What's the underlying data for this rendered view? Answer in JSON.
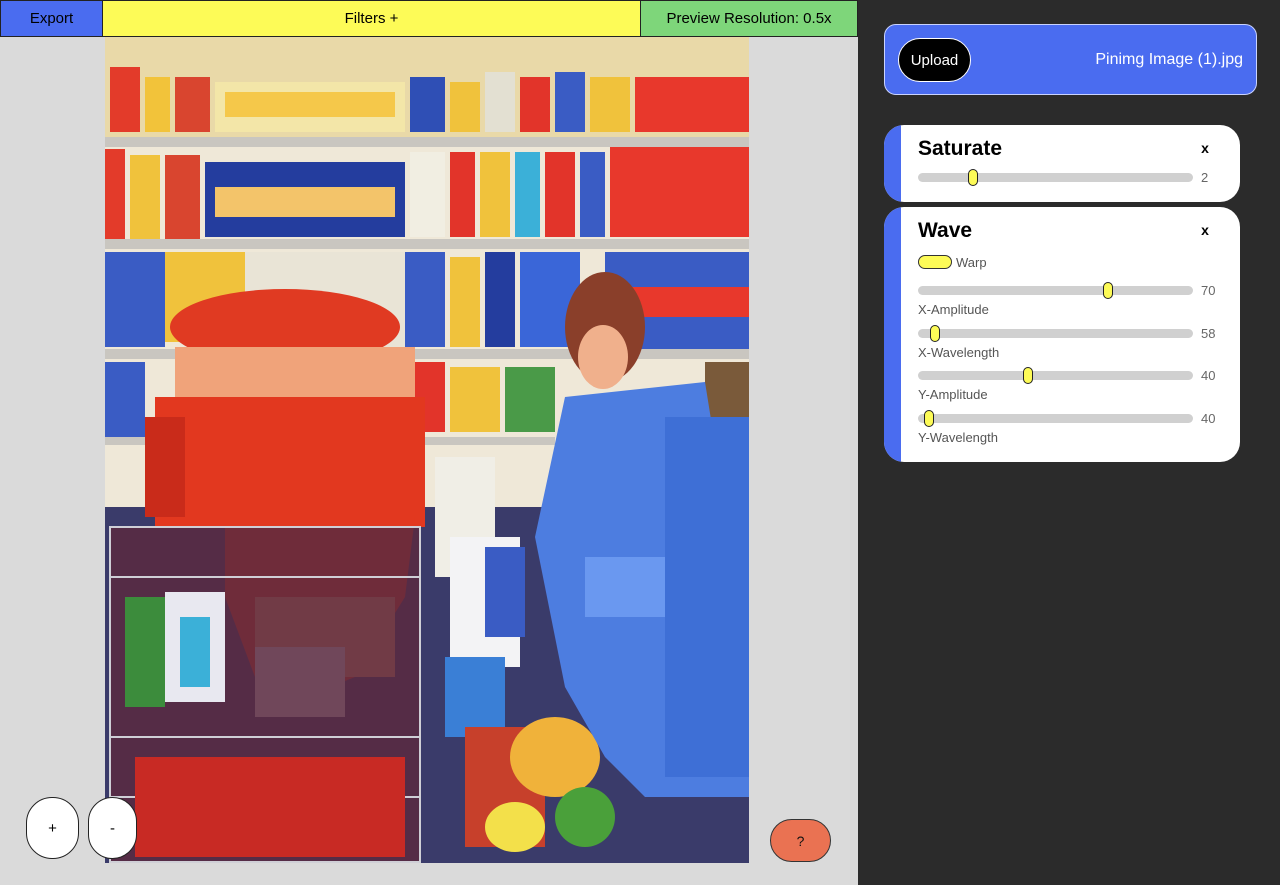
{
  "topbar": {
    "export_label": "Export",
    "filters_label": "Filters +",
    "resolution_label": "Preview Resolution: 0.5x"
  },
  "controls": {
    "zoom_in_label": "+",
    "zoom_out_label": "-",
    "help_label": "?"
  },
  "upload": {
    "button_label": "Upload",
    "file_name": "Pinimg Image (1).jpg"
  },
  "filters": {
    "saturate": {
      "title": "Saturate",
      "close_label": "x",
      "value": "2",
      "fraction": 0.2
    },
    "wave": {
      "title": "Wave",
      "close_label": "x",
      "toggle_label": "Warp",
      "sliders": [
        {
          "label": "X-Amplitude",
          "value": "70",
          "fraction": 0.69
        },
        {
          "label": "X-Wavelength",
          "value": "58",
          "fraction": 0.06
        },
        {
          "label": "Y-Amplitude",
          "value": "40",
          "fraction": 0.4
        },
        {
          "label": "Y-Wavelength",
          "value": "40",
          "fraction": 0.04
        }
      ]
    }
  },
  "colors": {
    "accent_blue": "#4a6cf0",
    "accent_yellow": "#fdfb57",
    "accent_green": "#7ed67a",
    "help_orange": "#ea7252"
  }
}
